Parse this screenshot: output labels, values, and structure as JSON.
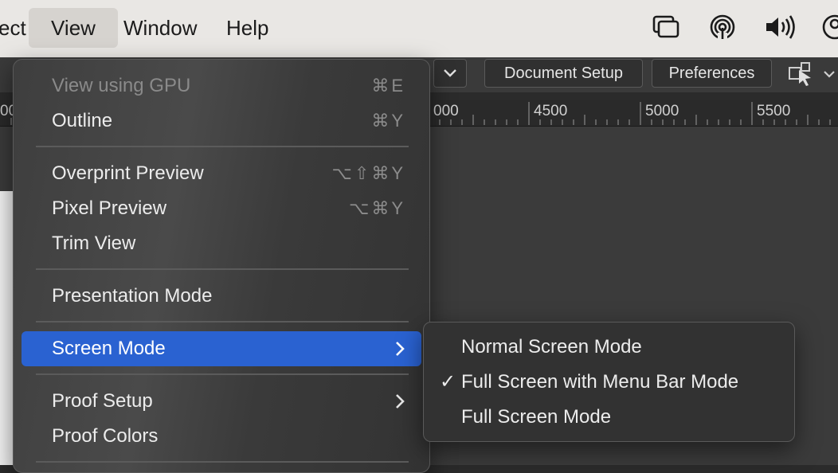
{
  "menubar": {
    "items": [
      {
        "label": "ect"
      },
      {
        "label": "View"
      },
      {
        "label": "Window"
      },
      {
        "label": "Help"
      }
    ]
  },
  "toolbar": {
    "document_setup": "Document Setup",
    "preferences": "Preferences"
  },
  "ruler": {
    "labels": [
      "00",
      "000",
      "4500",
      "5000",
      "5500"
    ]
  },
  "view_menu": {
    "items": [
      {
        "label": "View using GPU",
        "shortcut": "⌘E",
        "disabled": true
      },
      {
        "label": "Outline",
        "shortcut": "⌘Y"
      },
      {
        "label": "Overprint Preview",
        "shortcut": "⌥⇧⌘Y"
      },
      {
        "label": "Pixel Preview",
        "shortcut": "⌥⌘Y"
      },
      {
        "label": "Trim View"
      },
      {
        "label": "Presentation Mode"
      },
      {
        "label": "Screen Mode",
        "submenu": true,
        "highlighted": true
      },
      {
        "label": "Proof Setup",
        "submenu": true
      },
      {
        "label": "Proof Colors"
      }
    ]
  },
  "screen_mode_submenu": {
    "items": [
      {
        "label": "Normal Screen Mode",
        "checked": false
      },
      {
        "label": "Full Screen with Menu Bar Mode",
        "checked": true,
        "check": "✓"
      },
      {
        "label": "Full Screen Mode",
        "checked": false
      }
    ]
  },
  "colors": {
    "highlight": "#2a62d1",
    "menubar_bg": "#e9e7e4"
  }
}
